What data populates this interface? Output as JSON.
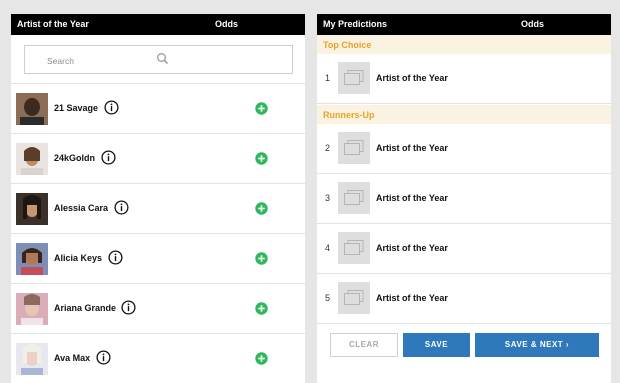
{
  "left_panel": {
    "header_title": "Artist of the Year",
    "header_odds": "Odds",
    "search_placeholder": "Search",
    "artists": [
      {
        "name": "21 Savage"
      },
      {
        "name": "24kGoldn"
      },
      {
        "name": "Alessia Cara"
      },
      {
        "name": "Alicia Keys"
      },
      {
        "name": "Ariana Grande"
      },
      {
        "name": "Ava Max"
      }
    ]
  },
  "right_panel": {
    "header_title": "My Predictions",
    "header_odds": "Odds",
    "top_choice_label": "Top Choice",
    "runners_up_label": "Runners-Up",
    "predictions": [
      {
        "rank": "1",
        "label": "Artist of the Year"
      },
      {
        "rank": "2",
        "label": "Artist of the Year"
      },
      {
        "rank": "3",
        "label": "Artist of the Year"
      },
      {
        "rank": "4",
        "label": "Artist of the Year"
      },
      {
        "rank": "5",
        "label": "Artist of the Year"
      }
    ],
    "buttons": {
      "clear": "CLEAR",
      "save": "SAVE",
      "save_next": "SAVE & NEXT ›"
    }
  },
  "colors": {
    "header_bg": "#000000",
    "section_label": "#e8a228",
    "section_bg": "#fbf3e2",
    "button_blue": "#2f78bc",
    "add_green": "#2eb85c"
  }
}
